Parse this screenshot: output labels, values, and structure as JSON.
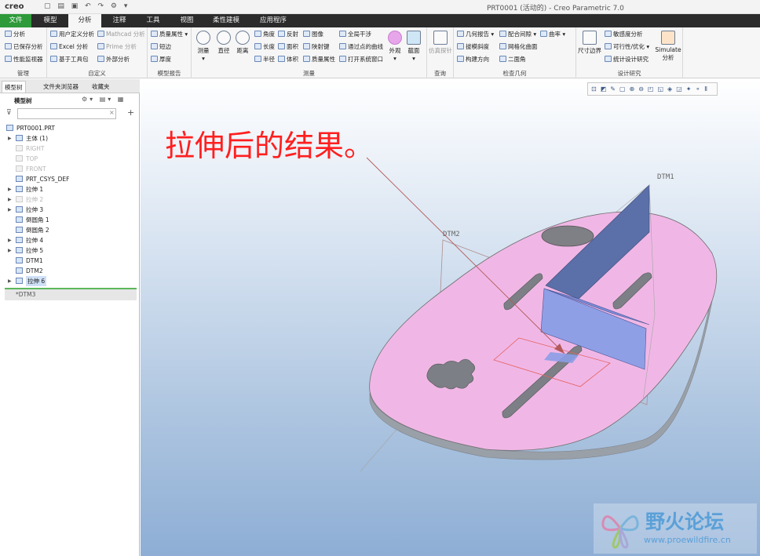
{
  "titlebar": {
    "logo": "creo",
    "window_title": "PRT0001 (活动的) - Creo Parametric 7.0"
  },
  "tabs": [
    "文件",
    "模型",
    "分析",
    "注释",
    "工具",
    "视图",
    "柔性建模",
    "应用程序"
  ],
  "ribbon": {
    "manage": {
      "label": "管理",
      "items": [
        "分析",
        "已保存分析",
        "性能监视器"
      ]
    },
    "custom": {
      "label": "自定义",
      "items": [
        "用户定义分析",
        "Mathcad 分析",
        "Excel 分析",
        "Prime 分析",
        "基于工具包",
        "外部分析"
      ]
    },
    "model_report": {
      "label": "模型报告",
      "items": [
        "质量属性",
        "短边",
        "厚度"
      ]
    },
    "measure": {
      "label": "测量",
      "big": [
        "测量",
        "直径",
        "距离"
      ],
      "items": [
        "角度",
        "反射",
        "图像",
        "全局干涉",
        "长度",
        "面积",
        "陕射键",
        "通过点的曲线",
        "半径",
        "体积",
        "质量属性",
        "打开系统窗口"
      ],
      "big2": [
        "外观",
        "截面"
      ]
    },
    "inspect": {
      "label": "查询",
      "items": [
        "仿真探针"
      ]
    },
    "check_geometry": {
      "label": "检查几何",
      "items": [
        "几何报告",
        "配合间隙",
        "曲率",
        "拔模斜度",
        "网格化曲面",
        "构建方向",
        "二面角"
      ]
    },
    "design_study": {
      "label": "设计研究",
      "items": [
        "尺寸边界",
        "敏感度分析",
        "可行性/优化",
        "统计设计研究",
        "Simulate 分析"
      ]
    }
  },
  "panel": {
    "tabs": [
      "模型树",
      "文件夹浏览器",
      "收藏夹"
    ],
    "tree_header": "模型树",
    "search_placeholder": "",
    "nodes": [
      {
        "label": "PRT0001.PRT",
        "state": "normal"
      },
      {
        "label": "主体 (1)",
        "state": "normal"
      },
      {
        "label": "RIGHT",
        "state": "gray"
      },
      {
        "label": "TOP",
        "state": "gray"
      },
      {
        "label": "FRONT",
        "state": "gray"
      },
      {
        "label": "PRT_CSYS_DEF",
        "state": "normal"
      },
      {
        "label": "拉伸 1",
        "state": "normal"
      },
      {
        "label": "拉伸 2",
        "state": "gray"
      },
      {
        "label": "拉伸 3",
        "state": "normal"
      },
      {
        "label": "倒圆角 1",
        "state": "normal"
      },
      {
        "label": "倒圆角 2",
        "state": "normal"
      },
      {
        "label": "拉伸 4",
        "state": "normal"
      },
      {
        "label": "拉伸 5",
        "state": "normal"
      },
      {
        "label": "DTM1",
        "state": "normal"
      },
      {
        "label": "DTM2",
        "state": "normal"
      },
      {
        "label": "拉伸 6",
        "state": "selected"
      }
    ],
    "insert_node": "*DTM3"
  },
  "viewport": {
    "annotation": "拉伸后的结果。",
    "datum1": "DTM1",
    "datum2": "DTM2",
    "colors": {
      "part": "#f0b7e6",
      "part_edge": "#9e9e9e",
      "wall": "#5b6fa8",
      "block": "#8f9fe6",
      "annot": "#ff1f1f"
    }
  },
  "watermark": {
    "title": "野火论坛",
    "url": "www.proewildfire.cn"
  }
}
